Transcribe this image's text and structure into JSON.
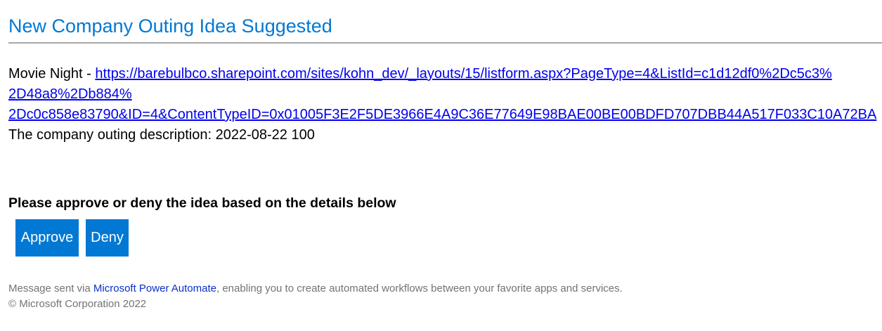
{
  "email": {
    "title": "New Company Outing Idea Suggested",
    "idea_name": "Movie Night",
    "separator": " - ",
    "link_lines": [
      "https://barebulbco.sharepoint.com/sites/kohn_dev/_layouts/15/listform.aspx?PageType=4&ListId=c1d12df0%2Dc5c3%",
      "2D48a8%2Db884%",
      "2Dc0c858e83790&ID=4&ContentTypeID=0x01005F3E2F5DE3966E4A9C36E77649E98BAE00BE00BDFD707DBB44A517F033C10A72BA"
    ],
    "description": "The company outing description: 2022-08-22 100",
    "prompt": "Please approve or deny the idea based on the details below",
    "buttons": {
      "approve": "Approve",
      "deny": "Deny"
    },
    "footer": {
      "prefix": "Message sent via ",
      "link": "Microsoft Power Automate",
      "suffix": ", enabling you to create automated workflows between your favorite apps and services.",
      "copyright": "© Microsoft Corporation 2022"
    }
  },
  "colors": {
    "accent": "#0078d4",
    "link": "#0000ee",
    "footer_text": "#737373",
    "divider": "#a8a8a8"
  }
}
